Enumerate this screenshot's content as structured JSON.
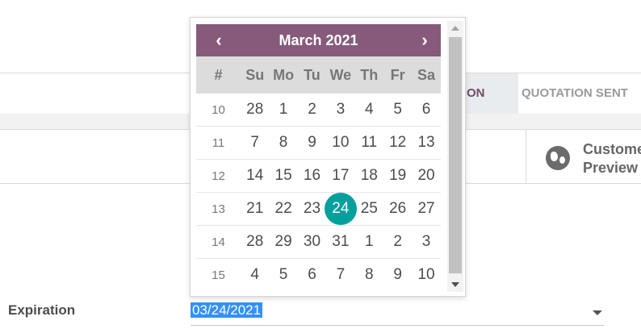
{
  "status": {
    "active_step": "ON",
    "next_step": "QUOTATION SENT"
  },
  "smart_button": {
    "icon": "globe-icon",
    "line1": "Custome",
    "line2": "Preview"
  },
  "field": {
    "label": "Expiration",
    "value": "03/24/2021"
  },
  "calendar": {
    "title": "March 2021",
    "prev_label": "‹",
    "next_label": "›",
    "week_header": "#",
    "days_of_week": [
      "Su",
      "Mo",
      "Tu",
      "We",
      "Th",
      "Fr",
      "Sa"
    ],
    "selected_day": "24",
    "weeks": [
      {
        "num": "10",
        "days": [
          "28",
          "1",
          "2",
          "3",
          "4",
          "5",
          "6"
        ]
      },
      {
        "num": "11",
        "days": [
          "7",
          "8",
          "9",
          "10",
          "11",
          "12",
          "13"
        ]
      },
      {
        "num": "12",
        "days": [
          "14",
          "15",
          "16",
          "17",
          "18",
          "19",
          "20"
        ]
      },
      {
        "num": "13",
        "days": [
          "21",
          "22",
          "23",
          "24",
          "25",
          "26",
          "27"
        ]
      },
      {
        "num": "14",
        "days": [
          "28",
          "29",
          "30",
          "31",
          "1",
          "2",
          "3"
        ]
      },
      {
        "num": "15",
        "days": [
          "4",
          "5",
          "6",
          "7",
          "8",
          "9",
          "10"
        ]
      }
    ],
    "colors": {
      "header": "#875a7b",
      "selected": "#00a09d",
      "dow_background": "#dcdcdc"
    }
  }
}
